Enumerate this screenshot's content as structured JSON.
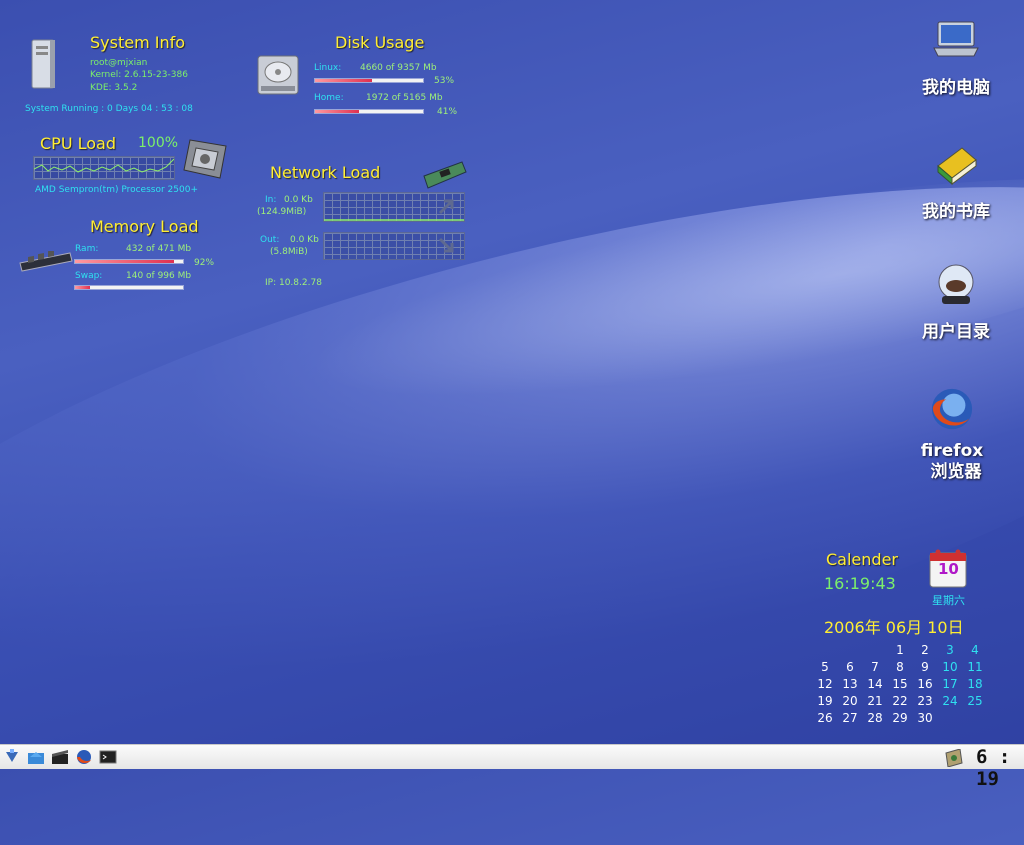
{
  "system_info": {
    "title": "System Info",
    "user": "root@mjxian",
    "kernel": "Kernel: 2.6.15-23-386",
    "kde": "KDE: 3.5.2",
    "uptime": "System Running : 0  Days  04 : 53 : 08"
  },
  "cpu": {
    "title": "CPU Load",
    "percent": "100%",
    "processor": "AMD Sempron(tm) Processor 2500+"
  },
  "memory": {
    "title": "Memory Load",
    "ram_label": "Ram:",
    "ram_value": "432  of  471 Mb",
    "ram_percent": "92%",
    "ram_fraction": 0.92,
    "swap_label": "Swap:",
    "swap_value": "140  of  996 Mb",
    "swap_fraction": 0.14
  },
  "disk": {
    "title": "Disk Usage",
    "linux_label": "Linux:",
    "linux_value": "4660  of  9357 Mb",
    "linux_percent": "53%",
    "linux_fraction": 0.53,
    "home_label": "Home:",
    "home_value": "1972  of  5165 Mb",
    "home_percent": "41%",
    "home_fraction": 0.41
  },
  "network": {
    "title": "Network Load",
    "in_label": "In:",
    "in_rate": "0.0 Kb",
    "in_total": "(124.9MiB)",
    "out_label": "Out:",
    "out_rate": "0.0 Kb",
    "out_total": "(5.8MiB)",
    "ip": "IP:  10.8.2.78"
  },
  "desktop_icons": {
    "computer": "我的电脑",
    "library": "我的书库",
    "home": "用户目录",
    "firefox_line1": "firefox",
    "firefox_line2": "浏览器"
  },
  "calendar": {
    "title": "Calender",
    "time": "16:19:43",
    "day_number": "10",
    "weekday": "星期六",
    "date": "2006年 06月 10日",
    "weeks": [
      [
        "",
        "",
        "",
        "1",
        "2",
        "3",
        "4"
      ],
      [
        "5",
        "6",
        "7",
        "8",
        "9",
        "10",
        "11"
      ],
      [
        "12",
        "13",
        "14",
        "15",
        "16",
        "17",
        "18"
      ],
      [
        "19",
        "20",
        "21",
        "22",
        "23",
        "24",
        "25"
      ],
      [
        "26",
        "27",
        "28",
        "29",
        "30",
        "",
        ""
      ]
    ]
  },
  "taskbar": {
    "clock": "6 : 19"
  },
  "colors": {
    "widget_title": "#ffee33",
    "label_cyan": "#2fe0f0",
    "value_green": "#7cf06a"
  }
}
